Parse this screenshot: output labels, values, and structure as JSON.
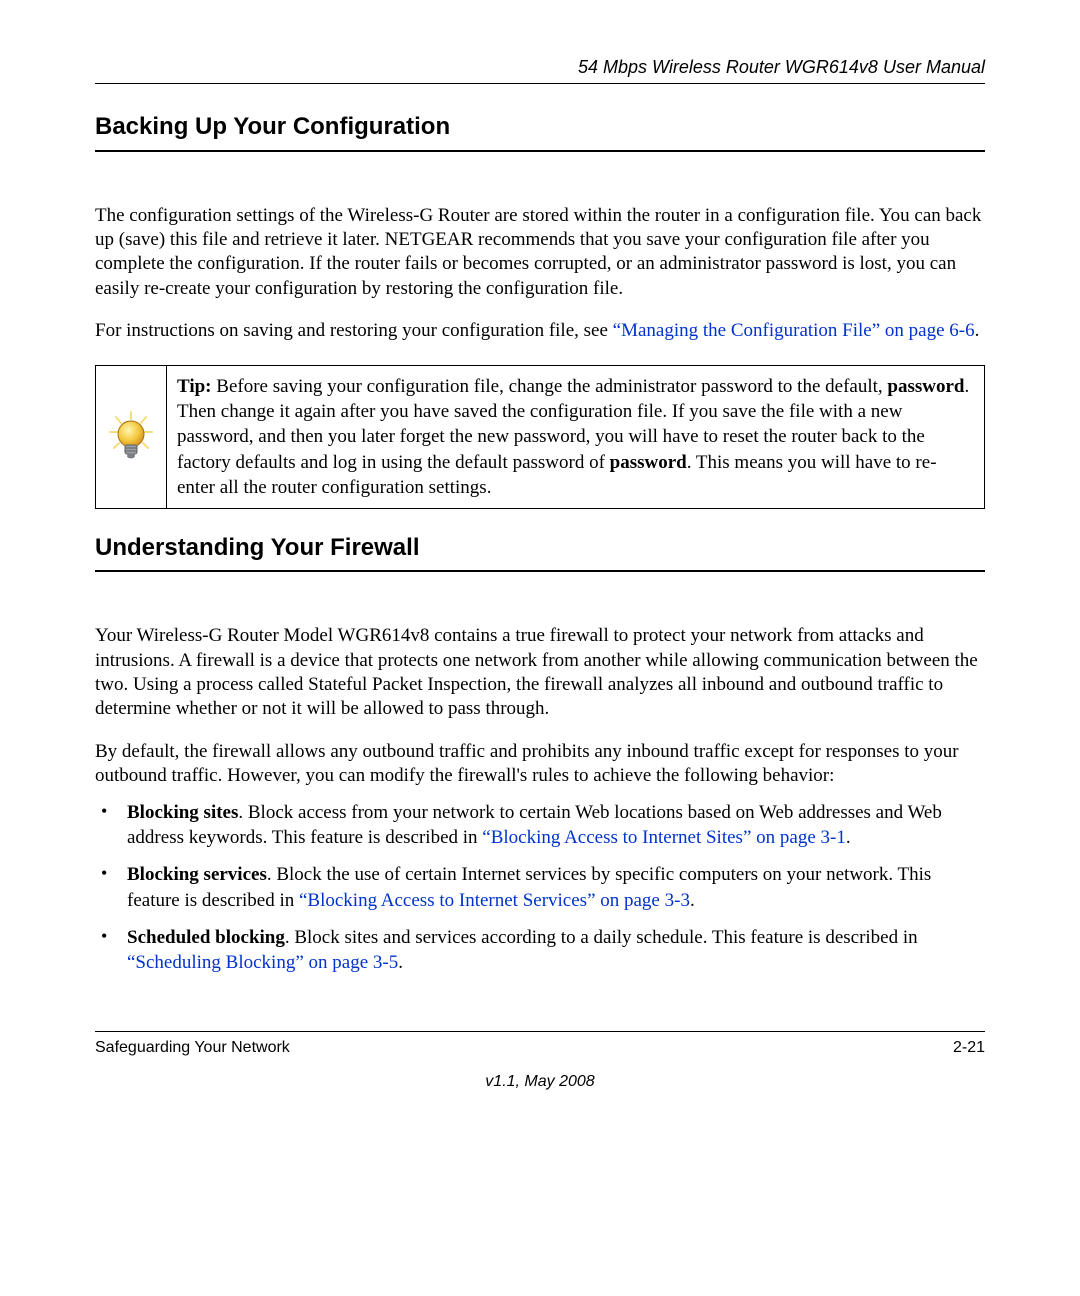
{
  "header": {
    "doc_title": "54 Mbps Wireless Router WGR614v8 User Manual"
  },
  "section1": {
    "heading": "Backing Up Your Configuration",
    "para1": "The configuration settings of the Wireless-G Router are stored within the router in a configuration file. You can back up (save) this file and retrieve it later. NETGEAR recommends that you save your configuration file after you complete the configuration. If the router fails or becomes corrupted, or an administrator password is lost, you can easily re-create your configuration by restoring the configuration file.",
    "para2_pre": "For instructions on saving and restoring your configuration file, see ",
    "para2_link": "“Managing the Configuration File” on page 6-6",
    "para2_post": "."
  },
  "tip": {
    "label": "Tip:",
    "text_a": " Before saving your configuration file, change the administrator password to the default, ",
    "bold1": "password",
    "text_b": ". Then change it again after you have saved the configuration file. If you save the file with a new password, and then you later forget the new password, you will have to reset the router back to the factory defaults and log in using the default password of ",
    "bold2": "password",
    "text_c": ". This means you will have to re-enter all the router configuration settings."
  },
  "section2": {
    "heading": "Understanding Your Firewall",
    "para1": "Your Wireless-G Router Model WGR614v8 contains a true firewall to protect your network from attacks and intrusions. A firewall is a device that protects one network from another while allowing communication between the two. Using a process called Stateful Packet Inspection, the firewall analyzes all inbound and outbound traffic to determine whether or not it will be allowed to pass through.",
    "para2": "By default, the firewall allows any outbound traffic and prohibits any inbound traffic except for responses to your outbound traffic. However, you can modify the firewall's rules to achieve the following behavior:"
  },
  "bullets": {
    "b1_bold": "Blocking sites",
    "b1_a": ". Block access from your network to certain Web locations based on Web addresses and Web address keywords. This feature is described in ",
    "b1_link": "“Blocking Access to Internet Sites” on page 3-1",
    "b1_b": ".",
    "b2_bold": "Blocking services",
    "b2_a": ". Block the use of certain Internet services by specific computers on your network. This feature is described in ",
    "b2_link": "“Blocking Access to Internet Services” on page 3-3",
    "b2_b": ".",
    "b3_bold": "Scheduled blocking",
    "b3_a": ". Block sites and services according to a daily schedule. This feature is described in ",
    "b3_link": "“Scheduling Blocking” on page 3-5",
    "b3_b": "."
  },
  "footer": {
    "section_name": "Safeguarding Your Network",
    "page_no": "2-21",
    "version": "v1.1, May 2008"
  }
}
